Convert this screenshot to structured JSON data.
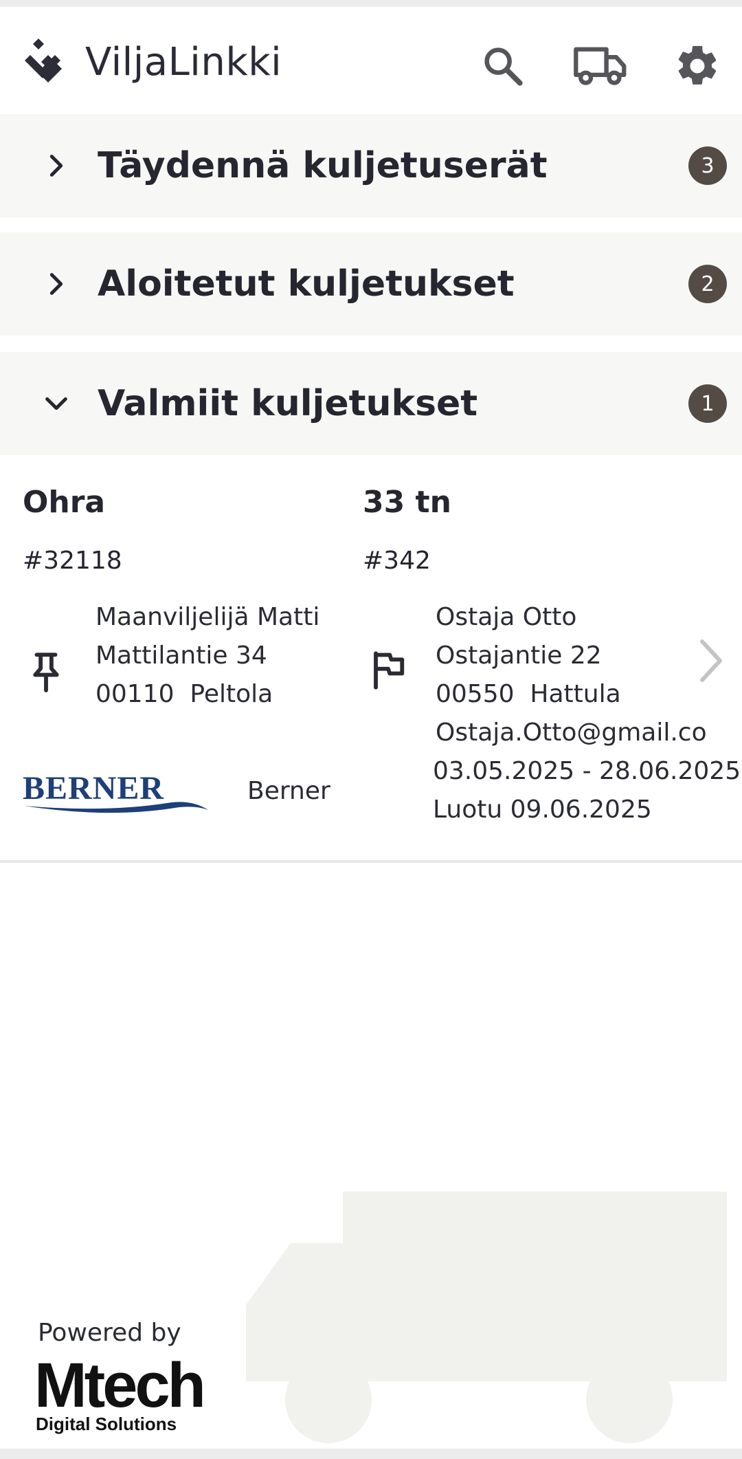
{
  "app": {
    "title": "ViljaLinkki",
    "logo_icon": "viljalinkki-logo-icon"
  },
  "header_actions": [
    {
      "name": "search-icon"
    },
    {
      "name": "truck-icon"
    },
    {
      "name": "gear-icon"
    }
  ],
  "sections": [
    {
      "label": "Täydennä kuljetuserät",
      "count": "3",
      "expanded": false
    },
    {
      "label": "Aloitetut kuljetukset",
      "count": "2",
      "expanded": false
    },
    {
      "label": "Valmiit kuljetukset",
      "count": "1",
      "expanded": true
    }
  ],
  "delivery": {
    "product": "Ohra",
    "amount": "33 tn",
    "seller_id": "#32118",
    "buyer_id": "#342",
    "seller": {
      "name": "Maanviljelijä Matti",
      "street": "Mattilantie 34",
      "city": "00110  Peltola"
    },
    "buyer": {
      "name": "Ostaja Otto",
      "street": "Ostajantie 22",
      "city": "00550  Hattula",
      "email": "Ostaja.Otto@gmail.co"
    },
    "date_range": "03.05.2025 - 28.06.2025",
    "created": "Luotu 09.06.2025",
    "carrier": {
      "logo_text": "BERNER",
      "name": "Berner"
    }
  },
  "footer": {
    "powered_by": "Powered by",
    "brand": "Mtech",
    "brand_sub": "Digital Solutions"
  },
  "colors": {
    "badge": "#554b45",
    "section_bg": "#f7f7f5",
    "berner_blue": "#1d3f7a",
    "truck_bg": "#f1f1ed"
  }
}
